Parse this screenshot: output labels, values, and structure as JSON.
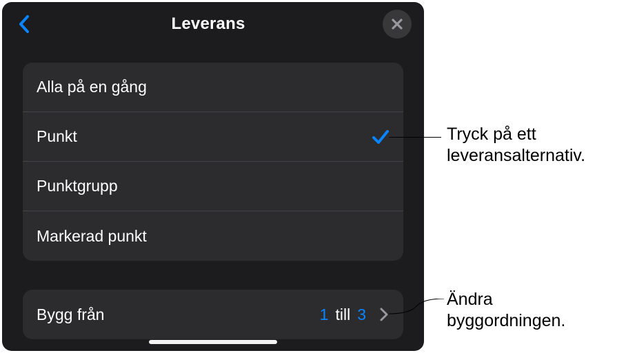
{
  "header": {
    "title": "Leverans"
  },
  "options": [
    {
      "label": "Alla på en gång",
      "selected": false
    },
    {
      "label": "Punkt",
      "selected": true
    },
    {
      "label": "Punktgrupp",
      "selected": false
    },
    {
      "label": "Markerad punkt",
      "selected": false
    }
  ],
  "build": {
    "label": "Bygg från",
    "from": "1",
    "conj": "till",
    "to": "3"
  },
  "callouts": {
    "c1_line1": "Tryck på ett",
    "c1_line2": "leveransalternativ.",
    "c2_line1": "Ändra",
    "c2_line2": "byggordningen."
  },
  "colors": {
    "accent": "#0a84ff"
  }
}
